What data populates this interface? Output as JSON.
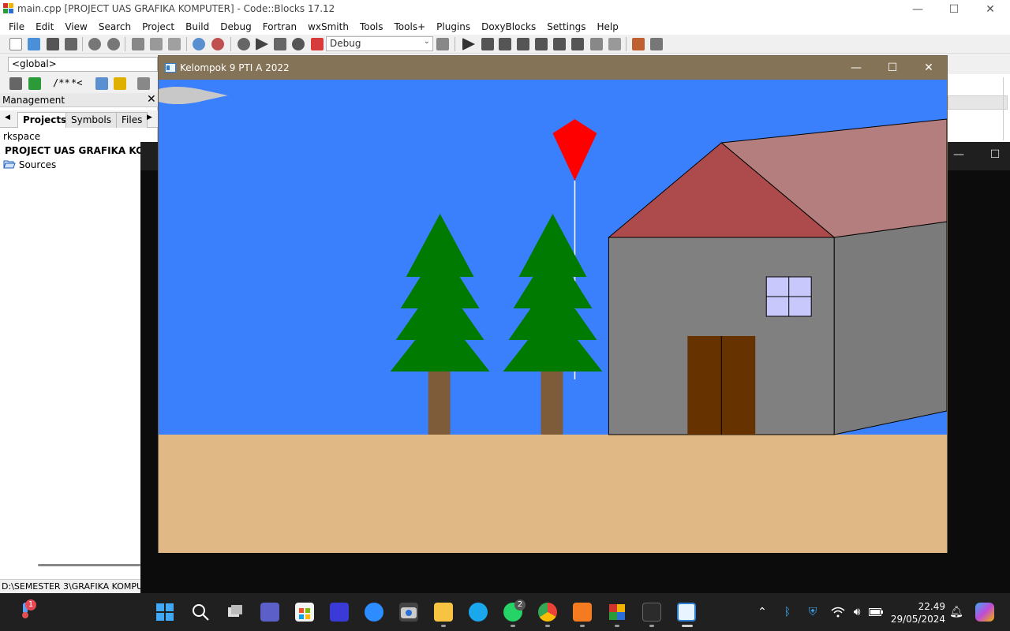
{
  "codeblocks": {
    "title": "main.cpp [PROJECT UAS GRAFIKA KOMPUTER] - Code::Blocks 17.12",
    "menu": [
      "File",
      "Edit",
      "View",
      "Search",
      "Project",
      "Build",
      "Debug",
      "Fortran",
      "wxSmith",
      "Tools",
      "Tools+",
      "Plugins",
      "DoxyBlocks",
      "Settings",
      "Help"
    ],
    "build_target": "Debug",
    "scope": "<global>",
    "doxy_comment_1": "/**",
    "doxy_comment_2": "*<",
    "management": {
      "title": "Management",
      "close": "✕",
      "tabs": [
        "Projects",
        "Symbols",
        "Files"
      ],
      "tree": [
        "rkspace",
        "PROJECT UAS GRAFIKA KOMPU",
        "Sources"
      ]
    },
    "status_path": "D:\\SEMESTER 3\\GRAFIKA KOMPU"
  },
  "gl_window": {
    "title": "Kelompok 9 PTI A 2022",
    "colors": {
      "sky": "#3a80fd",
      "ground": "#dfb886",
      "tree_leaves": "#007a00",
      "trunk": "#7f5c39",
      "wall_front": "#808080",
      "wall_side": "#7b7b7b",
      "roof_front": "#ad4a4c",
      "roof_side": "#b37e7d",
      "door": "#663300",
      "window": "#c9c8fd",
      "kite": "#ff0000",
      "cloud": "#c8c8c8"
    }
  },
  "window_controls": {
    "minimize": "—",
    "maximize": "☐",
    "close": "✕"
  },
  "taskbar": {
    "time": "22.49",
    "date": "29/05/2024",
    "badges": {
      "weather": "1",
      "whatsapp": "2"
    },
    "apps": [
      "start-icon",
      "search-icon",
      "task-view-icon",
      "teams-icon",
      "store-icon",
      "app-icon",
      "zoom-icon",
      "camera-icon",
      "file-explorer-icon",
      "edge-icon",
      "whatsapp-icon",
      "chrome-icon",
      "app-icon-2",
      "codeblocks-icon",
      "terminal-icon",
      "opengl-window-icon"
    ]
  }
}
